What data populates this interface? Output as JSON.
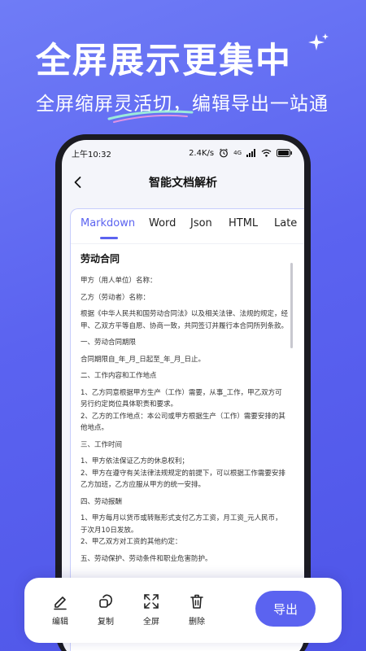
{
  "promo": {
    "headline": "全屏展示更集中",
    "subline": "全屏缩屏灵活切，编辑导出一站通"
  },
  "status_bar": {
    "time": "上午10:32",
    "speed": "2.4K/s",
    "signal": "4G"
  },
  "nav": {
    "title": "智能文档解析"
  },
  "tabs": [
    {
      "label": "Markdown",
      "active": true
    },
    {
      "label": "Word"
    },
    {
      "label": "Json"
    },
    {
      "label": "HTML"
    },
    {
      "label": "Late"
    }
  ],
  "document": {
    "title": "劳动合同",
    "paragraphs": [
      "甲方（用人单位）名称：",
      "乙方（劳动者）名称：",
      "根据《中华人民共和国劳动合同法》以及相关法律、法规的规定，经甲、乙双方平等自愿、协商一致，共同签订并履行本合同所列条款。",
      "一、劳动合同期限",
      "合同期限自_年_月_日起至_年_月_日止。",
      "二、工作内容和工作地点",
      "1、乙方同意根据甲方生产（工作）需要，从事_工作，甲乙双方可另行约定岗位具体职责和要求。\n2、乙方的工作地点：本公司或甲方根据生产（工作）需要安排的其他地点。",
      "三、工作时间",
      "1、甲方依法保证乙方的休息权利；\n2、甲方在遵守有关法律法规规定的前提下，可以根据工作需要安排乙方加班，乙方应服从甲方的统一安排。",
      "四、劳动报酬",
      "1、甲方每月以货币或转账形式支付乙方工资，月工资_元人民币，于次月10日发放。\n2、甲乙双方对工资的其他约定：",
      "五、劳动保护、劳动条件和职业危害防护。"
    ]
  },
  "toolbar": {
    "edit_label": "编辑",
    "copy_label": "复制",
    "fullscreen_label": "全屏",
    "delete_label": "删除",
    "export_label": "导出"
  },
  "colors": {
    "accent": "#5b63f0",
    "background": "#6f7cf6"
  }
}
